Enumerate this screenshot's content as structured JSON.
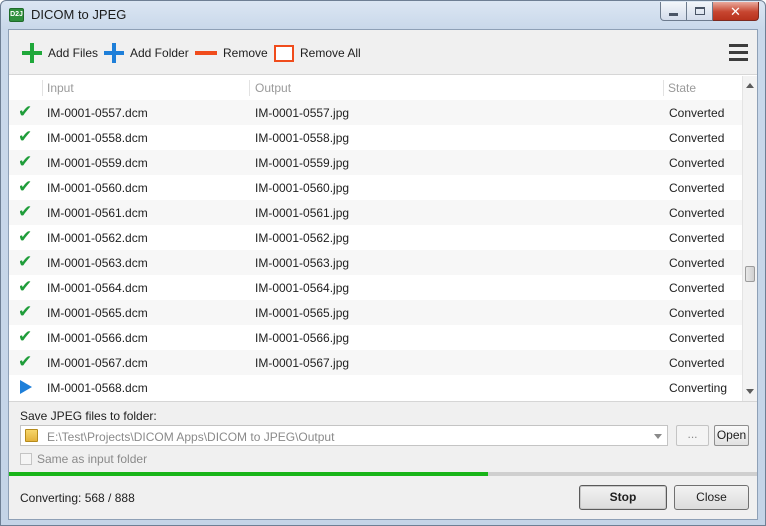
{
  "window": {
    "title": "DICOM to JPEG",
    "app_icon_text": "D2J"
  },
  "toolbar": {
    "add_files": "Add Files",
    "add_folder": "Add Folder",
    "remove": "Remove",
    "remove_all": "Remove All"
  },
  "list": {
    "columns": {
      "input": "Input",
      "output": "Output",
      "state": "State"
    },
    "rows": [
      {
        "status": "converted",
        "input": "IM-0001-0557.dcm",
        "output": "IM-0001-0557.jpg",
        "state": "Converted"
      },
      {
        "status": "converted",
        "input": "IM-0001-0558.dcm",
        "output": "IM-0001-0558.jpg",
        "state": "Converted"
      },
      {
        "status": "converted",
        "input": "IM-0001-0559.dcm",
        "output": "IM-0001-0559.jpg",
        "state": "Converted"
      },
      {
        "status": "converted",
        "input": "IM-0001-0560.dcm",
        "output": "IM-0001-0560.jpg",
        "state": "Converted"
      },
      {
        "status": "converted",
        "input": "IM-0001-0561.dcm",
        "output": "IM-0001-0561.jpg",
        "state": "Converted"
      },
      {
        "status": "converted",
        "input": "IM-0001-0562.dcm",
        "output": "IM-0001-0562.jpg",
        "state": "Converted"
      },
      {
        "status": "converted",
        "input": "IM-0001-0563.dcm",
        "output": "IM-0001-0563.jpg",
        "state": "Converted"
      },
      {
        "status": "converted",
        "input": "IM-0001-0564.dcm",
        "output": "IM-0001-0564.jpg",
        "state": "Converted"
      },
      {
        "status": "converted",
        "input": "IM-0001-0565.dcm",
        "output": "IM-0001-0565.jpg",
        "state": "Converted"
      },
      {
        "status": "converted",
        "input": "IM-0001-0566.dcm",
        "output": "IM-0001-0566.jpg",
        "state": "Converted"
      },
      {
        "status": "converted",
        "input": "IM-0001-0567.dcm",
        "output": "IM-0001-0567.jpg",
        "state": "Converted"
      },
      {
        "status": "converting",
        "input": "IM-0001-0568.dcm",
        "output": "",
        "state": "Converting"
      }
    ]
  },
  "output": {
    "save_label": "Save JPEG files to folder:",
    "path": "E:\\Test\\Projects\\DICOM Apps\\DICOM to JPEG\\Output",
    "browse_label": "...",
    "open_label": "Open",
    "same_as_input_label": "Same as input folder",
    "same_as_input_checked": false
  },
  "progress": {
    "current": 568,
    "total": 888,
    "fraction": 0.64
  },
  "status": {
    "text": "Converting: 568 / 888"
  },
  "buttons": {
    "stop": "Stop",
    "close": "Close"
  },
  "colors": {
    "add_icon_green": "#1fa83a",
    "add_icon_blue": "#1e7fd9",
    "remove_red": "#f04c1c",
    "check_green": "#1f9d3a",
    "progress_green": "#18b418"
  },
  "icons": {
    "add_files": "plus-icon",
    "add_folder": "plus-icon",
    "remove": "minus-icon",
    "remove_all": "box-icon",
    "menu": "hamburger-icon",
    "converted": "checkmark-icon",
    "converting": "play-icon",
    "folder": "folder-icon"
  }
}
